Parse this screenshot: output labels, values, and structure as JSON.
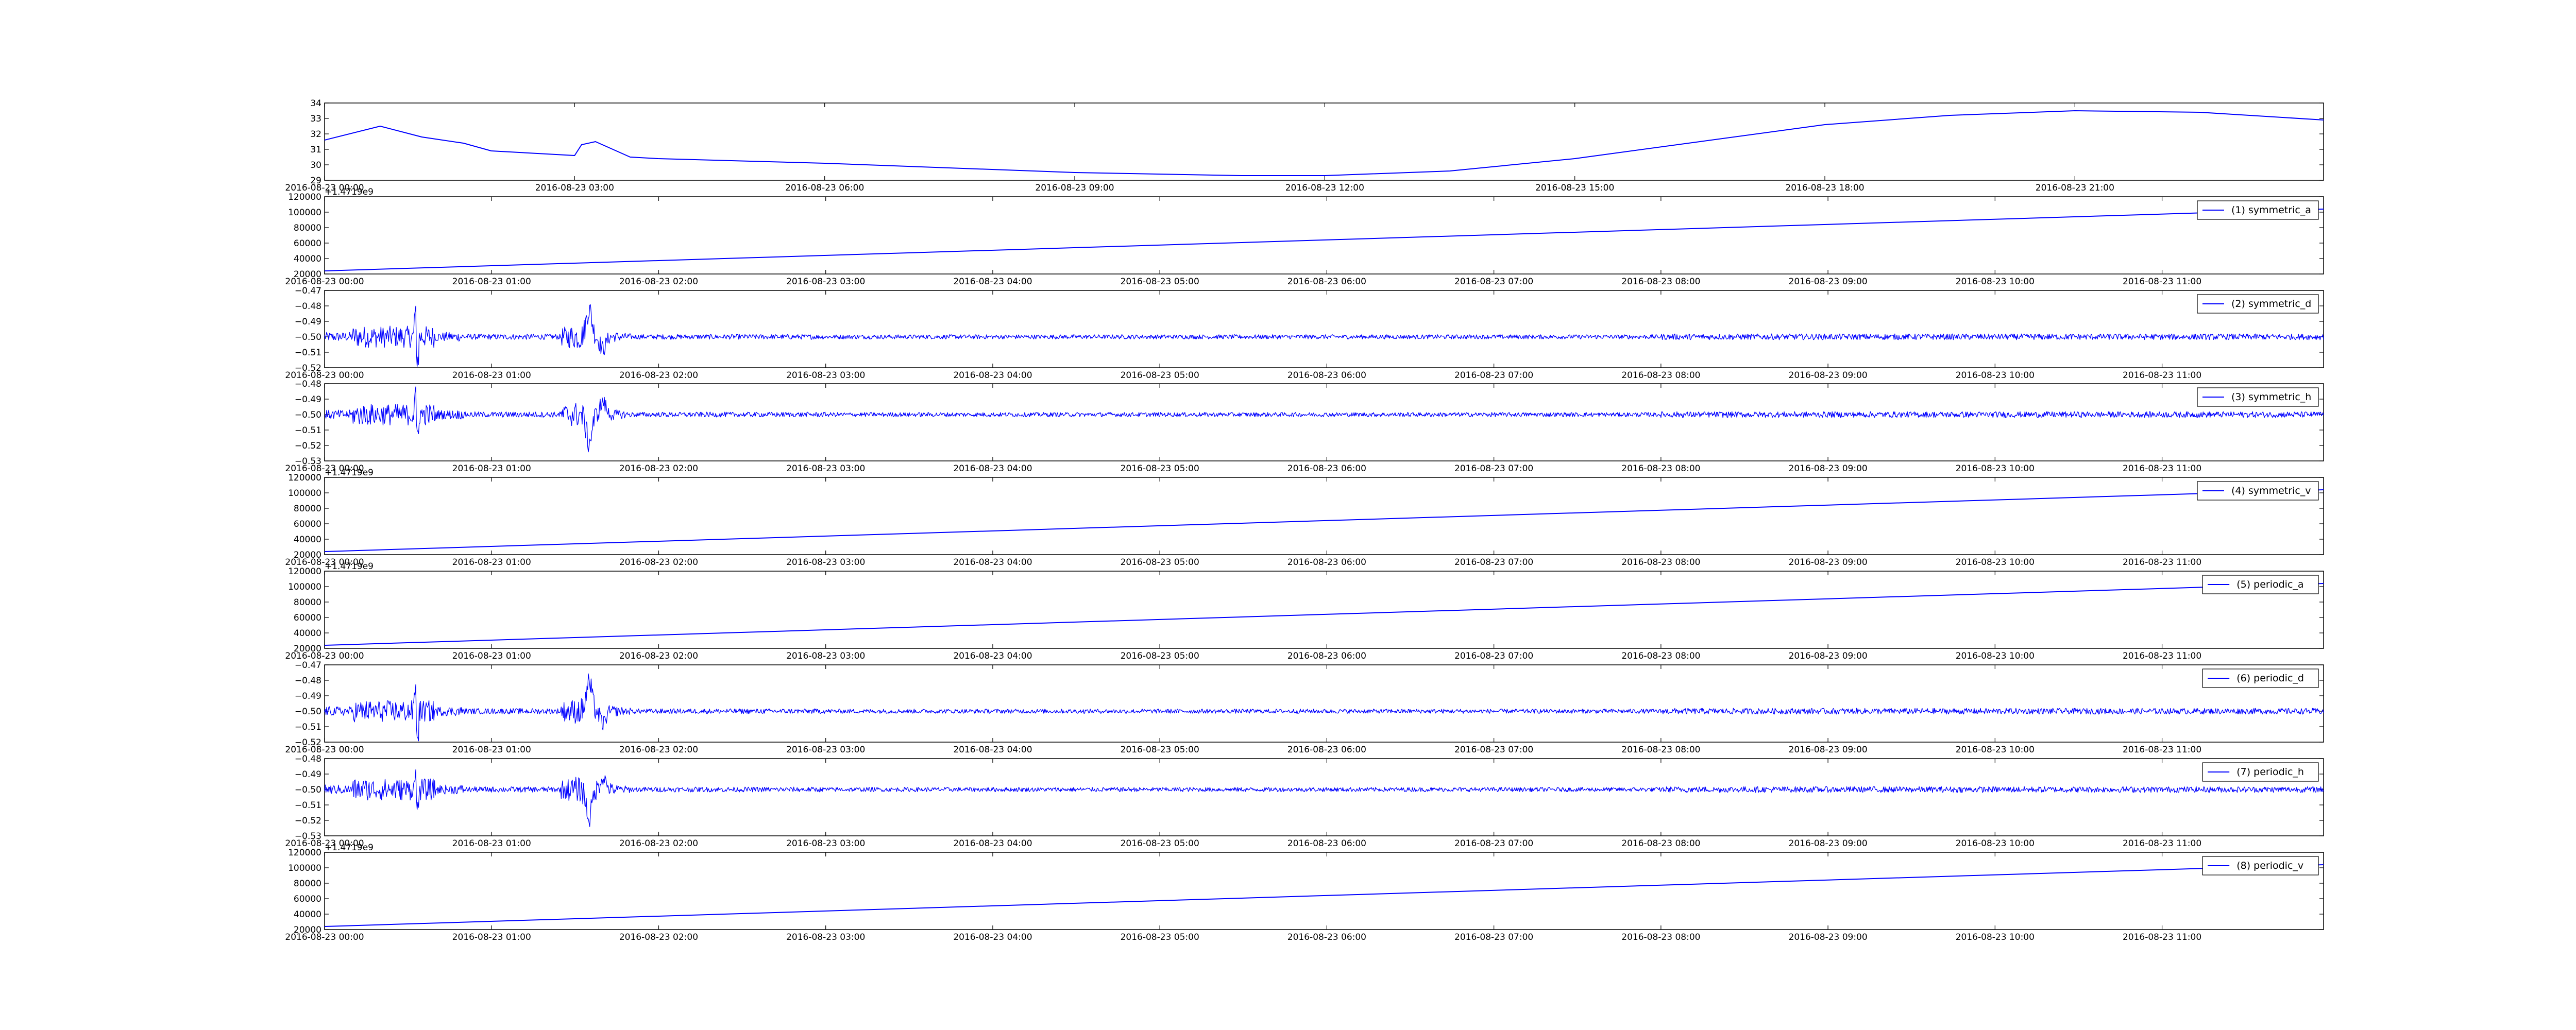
{
  "chart_data": [
    {
      "type": "line",
      "title": "",
      "x": [
        "2016-08-23 00:00",
        "2016-08-23 00:40",
        "2016-08-23 01:10",
        "2016-08-23 01:40",
        "2016-08-23 02:00",
        "2016-08-23 02:40",
        "2016-08-23 03:00",
        "2016-08-23 03:05",
        "2016-08-23 03:15",
        "2016-08-23 03:40",
        "2016-08-23 04:00",
        "2016-08-23 04:40",
        "2016-08-23 06:00",
        "2016-08-23 09:00",
        "2016-08-23 11:00",
        "2016-08-23 12:00",
        "2016-08-23 13:30",
        "2016-08-23 15:00",
        "2016-08-23 16:30",
        "2016-08-23 18:00",
        "2016-08-23 19:30",
        "2016-08-23 21:00",
        "2016-08-23 22:30",
        "2016-08-23 23:59"
      ],
      "values": [
        31.6,
        32.5,
        31.8,
        31.4,
        30.9,
        30.7,
        30.6,
        31.3,
        31.5,
        30.5,
        30.4,
        30.3,
        30.1,
        29.5,
        29.3,
        29.3,
        29.6,
        30.4,
        31.5,
        32.6,
        33.2,
        33.5,
        33.4,
        32.9
      ],
      "ylim": [
        29,
        34
      ],
      "yticks": [
        "29",
        "30",
        "31",
        "32",
        "33",
        "34"
      ],
      "xticks": [
        "2016-08-23 00:00",
        "2016-08-23 03:00",
        "2016-08-23 06:00",
        "2016-08-23 09:00",
        "2016-08-23 12:00",
        "2016-08-23 15:00",
        "2016-08-23 18:00",
        "2016-08-23 21:00"
      ],
      "offset_text": "",
      "legend": "",
      "color": "#0000ff"
    },
    {
      "type": "line",
      "x": [
        "2016-08-23 00:00",
        "2016-08-23 11:58"
      ],
      "values": [
        24000,
        104000
      ],
      "ylim": [
        20000,
        120000
      ],
      "yticks": [
        "20000",
        "40000",
        "60000",
        "80000",
        "100000",
        "120000"
      ],
      "xticks": [
        "2016-08-23 00:00",
        "2016-08-23 01:00",
        "2016-08-23 02:00",
        "2016-08-23 03:00",
        "2016-08-23 04:00",
        "2016-08-23 05:00",
        "2016-08-23 06:00",
        "2016-08-23 07:00",
        "2016-08-23 08:00",
        "2016-08-23 09:00",
        "2016-08-23 10:00",
        "2016-08-23 11:00"
      ],
      "offset_text": "+1.4719e9",
      "legend": "(1) symmetric_a",
      "color": "#0000ff"
    },
    {
      "type": "line",
      "noise": "d",
      "baseline": -0.5,
      "ylim": [
        -0.52,
        -0.47
      ],
      "yticks": [
        "−0.52",
        "−0.51",
        "−0.50",
        "−0.49",
        "−0.48",
        "−0.47"
      ],
      "xticks": [
        "2016-08-23 00:00",
        "2016-08-23 01:00",
        "2016-08-23 02:00",
        "2016-08-23 03:00",
        "2016-08-23 04:00",
        "2016-08-23 05:00",
        "2016-08-23 06:00",
        "2016-08-23 07:00",
        "2016-08-23 08:00",
        "2016-08-23 09:00",
        "2016-08-23 10:00",
        "2016-08-23 11:00"
      ],
      "offset_text": "",
      "legend": "(2) symmetric_d",
      "color": "#0000ff"
    },
    {
      "type": "line",
      "noise": "h",
      "baseline": -0.5,
      "ylim": [
        -0.53,
        -0.48
      ],
      "yticks": [
        "−0.53",
        "−0.52",
        "−0.51",
        "−0.50",
        "−0.49",
        "−0.48"
      ],
      "xticks": [
        "2016-08-23 00:00",
        "2016-08-23 01:00",
        "2016-08-23 02:00",
        "2016-08-23 03:00",
        "2016-08-23 04:00",
        "2016-08-23 05:00",
        "2016-08-23 06:00",
        "2016-08-23 07:00",
        "2016-08-23 08:00",
        "2016-08-23 09:00",
        "2016-08-23 10:00",
        "2016-08-23 11:00"
      ],
      "offset_text": "",
      "legend": "(3) symmetric_h",
      "color": "#0000ff"
    },
    {
      "type": "line",
      "x": [
        "2016-08-23 00:00",
        "2016-08-23 11:58"
      ],
      "values": [
        24000,
        104000
      ],
      "ylim": [
        20000,
        120000
      ],
      "yticks": [
        "20000",
        "40000",
        "60000",
        "80000",
        "100000",
        "120000"
      ],
      "xticks": [
        "2016-08-23 00:00",
        "2016-08-23 01:00",
        "2016-08-23 02:00",
        "2016-08-23 03:00",
        "2016-08-23 04:00",
        "2016-08-23 05:00",
        "2016-08-23 06:00",
        "2016-08-23 07:00",
        "2016-08-23 08:00",
        "2016-08-23 09:00",
        "2016-08-23 10:00",
        "2016-08-23 11:00"
      ],
      "offset_text": "+1.4719e9",
      "legend": "(4) symmetric_v",
      "color": "#0000ff"
    },
    {
      "type": "line",
      "x": [
        "2016-08-23 00:00",
        "2016-08-23 11:58"
      ],
      "values": [
        24000,
        104000
      ],
      "ylim": [
        20000,
        120000
      ],
      "yticks": [
        "20000",
        "40000",
        "60000",
        "80000",
        "100000",
        "120000"
      ],
      "xticks": [
        "2016-08-23 00:00",
        "2016-08-23 01:00",
        "2016-08-23 02:00",
        "2016-08-23 03:00",
        "2016-08-23 04:00",
        "2016-08-23 05:00",
        "2016-08-23 06:00",
        "2016-08-23 07:00",
        "2016-08-23 08:00",
        "2016-08-23 09:00",
        "2016-08-23 10:00",
        "2016-08-23 11:00"
      ],
      "offset_text": "+1.4719e9",
      "legend": "(5) periodic_a",
      "color": "#0000ff"
    },
    {
      "type": "line",
      "noise": "d",
      "baseline": -0.5,
      "ylim": [
        -0.52,
        -0.47
      ],
      "yticks": [
        "−0.52",
        "−0.51",
        "−0.50",
        "−0.49",
        "−0.48",
        "−0.47"
      ],
      "xticks": [
        "2016-08-23 00:00",
        "2016-08-23 01:00",
        "2016-08-23 02:00",
        "2016-08-23 03:00",
        "2016-08-23 04:00",
        "2016-08-23 05:00",
        "2016-08-23 06:00",
        "2016-08-23 07:00",
        "2016-08-23 08:00",
        "2016-08-23 09:00",
        "2016-08-23 10:00",
        "2016-08-23 11:00"
      ],
      "offset_text": "",
      "legend": "(6) periodic_d",
      "color": "#0000ff"
    },
    {
      "type": "line",
      "noise": "h",
      "baseline": -0.5,
      "ylim": [
        -0.53,
        -0.48
      ],
      "yticks": [
        "−0.53",
        "−0.52",
        "−0.51",
        "−0.50",
        "−0.49",
        "−0.48"
      ],
      "xticks": [
        "2016-08-23 00:00",
        "2016-08-23 01:00",
        "2016-08-23 02:00",
        "2016-08-23 03:00",
        "2016-08-23 04:00",
        "2016-08-23 05:00",
        "2016-08-23 06:00",
        "2016-08-23 07:00",
        "2016-08-23 08:00",
        "2016-08-23 09:00",
        "2016-08-23 10:00",
        "2016-08-23 11:00"
      ],
      "offset_text": "",
      "legend": "(7) periodic_h",
      "color": "#0000ff"
    },
    {
      "type": "line",
      "x": [
        "2016-08-23 00:00",
        "2016-08-23 11:58"
      ],
      "values": [
        24000,
        104000
      ],
      "ylim": [
        20000,
        120000
      ],
      "yticks": [
        "20000",
        "40000",
        "60000",
        "80000",
        "100000",
        "120000"
      ],
      "xticks": [
        "2016-08-23 00:00",
        "2016-08-23 01:00",
        "2016-08-23 02:00",
        "2016-08-23 03:00",
        "2016-08-23 04:00",
        "2016-08-23 05:00",
        "2016-08-23 06:00",
        "2016-08-23 07:00",
        "2016-08-23 08:00",
        "2016-08-23 09:00",
        "2016-08-23 10:00",
        "2016-08-23 11:00"
      ],
      "offset_text": "+1.4719e9",
      "legend": "(8) periodic_v",
      "color": "#0000ff"
    }
  ]
}
